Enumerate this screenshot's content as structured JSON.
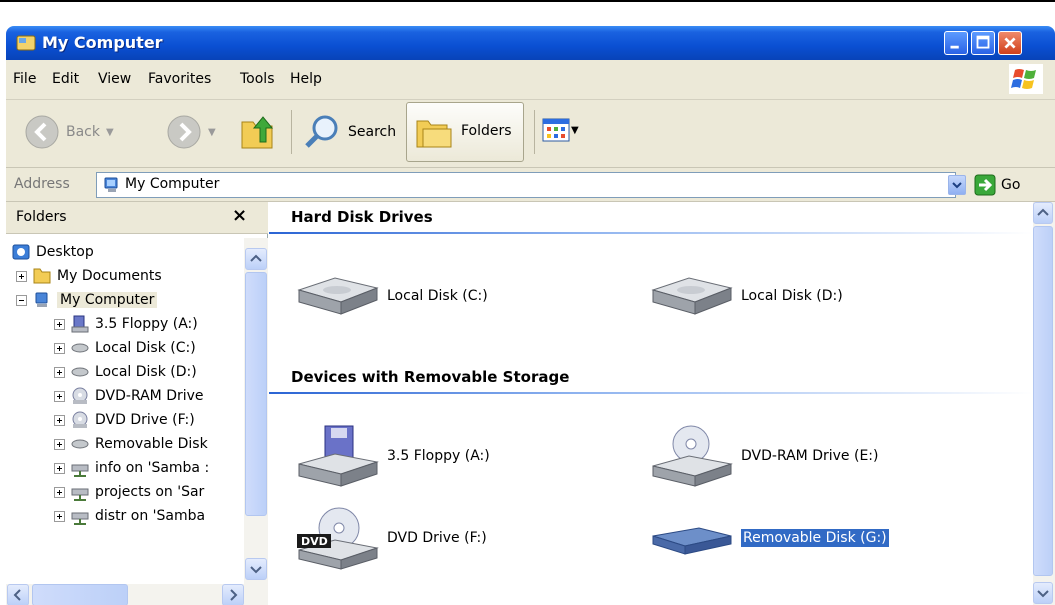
{
  "window": {
    "title": "My Computer"
  },
  "menu": [
    "File",
    "Edit",
    "View",
    "Favorites",
    "Tools",
    "Help"
  ],
  "toolbar": {
    "back": "Back",
    "search": "Search",
    "folders": "Folders"
  },
  "address": {
    "label": "Address",
    "value": "My Computer",
    "go": "Go"
  },
  "folders_pane": {
    "title": "Folders",
    "close": "×",
    "tree": [
      {
        "label": "Desktop",
        "icon": "desktop-icon",
        "level": 0
      },
      {
        "label": "My Documents",
        "icon": "folder-icon",
        "level": 1
      },
      {
        "label": "My Computer",
        "icon": "computer-icon",
        "level": 1
      },
      {
        "label": "3.5 Floppy (A:)",
        "icon": "floppy-icon",
        "level": 2
      },
      {
        "label": "Local Disk (C:)",
        "icon": "disk-icon",
        "level": 2
      },
      {
        "label": "Local Disk (D:)",
        "icon": "disk-icon",
        "level": 2
      },
      {
        "label": "DVD-RAM Drive",
        "icon": "cd-icon",
        "level": 2
      },
      {
        "label": "DVD Drive (F:)",
        "icon": "cd-icon",
        "level": 2
      },
      {
        "label": "Removable Disk",
        "icon": "disk-icon",
        "level": 2
      },
      {
        "label": "info on 'Samba :",
        "icon": "network-drive-icon",
        "level": 2
      },
      {
        "label": "projects on 'Sar",
        "icon": "network-drive-icon",
        "level": 2
      },
      {
        "label": "distr on 'Samba",
        "icon": "network-drive-icon",
        "level": 2
      }
    ]
  },
  "main": {
    "groups": [
      {
        "title": "Hard Disk Drives",
        "items": [
          {
            "label": "Local Disk (C:)",
            "icon": "hard-disk-icon"
          },
          {
            "label": "Local Disk (D:)",
            "icon": "hard-disk-icon"
          }
        ]
      },
      {
        "title": "Devices with Removable Storage",
        "items": [
          {
            "label": "3.5 Floppy (A:)",
            "icon": "floppy-drive-icon"
          },
          {
            "label": "DVD-RAM Drive (E:)",
            "icon": "cd-drive-icon"
          },
          {
            "label": "DVD Drive (F:)",
            "icon": "dvd-drive-icon"
          },
          {
            "label": "Removable Disk (G:)",
            "icon": "removable-disk-icon",
            "selected": true
          }
        ]
      }
    ],
    "dvd_badge": "DVD"
  },
  "colors": {
    "titlebar": "#0a4fd2",
    "selection": "#316ac5",
    "chrome": "#ece9d8"
  }
}
